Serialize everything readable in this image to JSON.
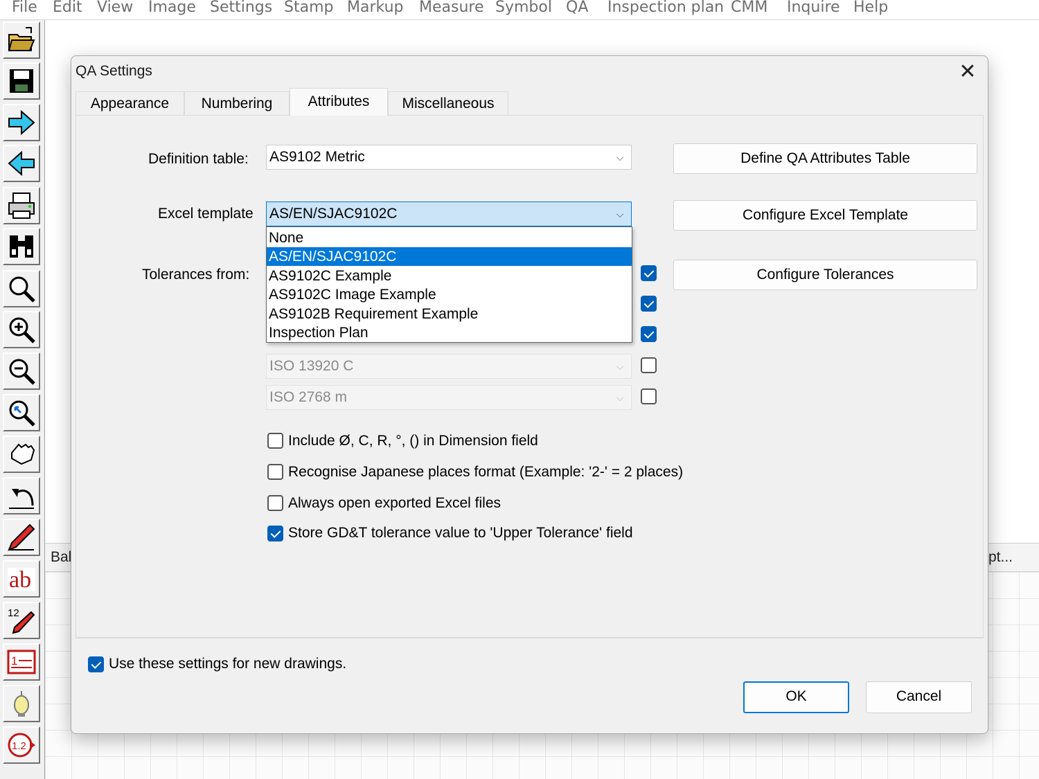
{
  "menu": [
    "File",
    "Edit",
    "View",
    "Image",
    "Settings",
    "Stamp",
    "Markup",
    "Measure",
    "Symbol",
    "QA",
    "Inspection plan",
    "CMM",
    "Inquire",
    "Help"
  ],
  "toolbar_icons": [
    "open-folder-icon",
    "save-icon",
    "forward-arrow-icon",
    "back-arrow-icon",
    "print-icon",
    "binoculars-icon",
    "zoom-icon",
    "zoom-in-icon",
    "zoom-out-icon",
    "zoom-fit-icon",
    "pan-hand-icon",
    "undo-icon",
    "pencil-icon",
    "text-ab-icon",
    "auto-number-icon",
    "balloon-list-icon",
    "bulb-icon",
    "balloon-marker-icon"
  ],
  "toolbar_text": {
    "ab": "ab",
    "num": "12",
    "list": "1",
    "marker": "1.2"
  },
  "workspace": {
    "strip_left": "Bal",
    "strip_right": "pt..."
  },
  "dialog": {
    "title": "QA Settings",
    "close": "✕",
    "tabs": [
      "Appearance",
      "Numbering",
      "Attributes",
      "Miscellaneous"
    ],
    "active_tab": "Attributes",
    "definition_table": {
      "label": "Definition table:",
      "value": "AS9102 Metric"
    },
    "excel_template": {
      "label": "Excel template",
      "value": "AS/EN/SJAC9102C",
      "options": [
        "None",
        "AS/EN/SJAC9102C",
        "AS9102C Example",
        "AS9102C Image Example",
        "AS9102B Requirement Example",
        "Inspection Plan"
      ],
      "selected_index": 1
    },
    "tolerances": {
      "label": "Tolerances from:",
      "rows": [
        {
          "value": "",
          "checked": true
        },
        {
          "value": "",
          "checked": true
        },
        {
          "value": "",
          "checked": true
        },
        {
          "value": "ISO 13920 C",
          "checked": false
        },
        {
          "value": "ISO 2768 m",
          "checked": false
        }
      ]
    },
    "buttons": {
      "define": "Define QA Attributes Table",
      "configure_excel": "Configure Excel Template",
      "configure_tol": "Configure Tolerances",
      "ok": "OK",
      "cancel": "Cancel"
    },
    "options": [
      {
        "label": "Include Ø, C, R, °, () in Dimension field",
        "checked": false
      },
      {
        "label": "Recognise Japanese places format (Example: '2-' = 2 places)",
        "checked": false
      },
      {
        "label": "Always open exported Excel files",
        "checked": false
      },
      {
        "label": "Store GD&T tolerance value to 'Upper Tolerance' field",
        "checked": true
      }
    ],
    "use_settings": {
      "label": "Use these settings for new drawings.",
      "checked": true
    }
  },
  "colors": {
    "accent": "#0078d7",
    "check": "#005fb8",
    "dialog_bg": "#f0f0f0"
  }
}
